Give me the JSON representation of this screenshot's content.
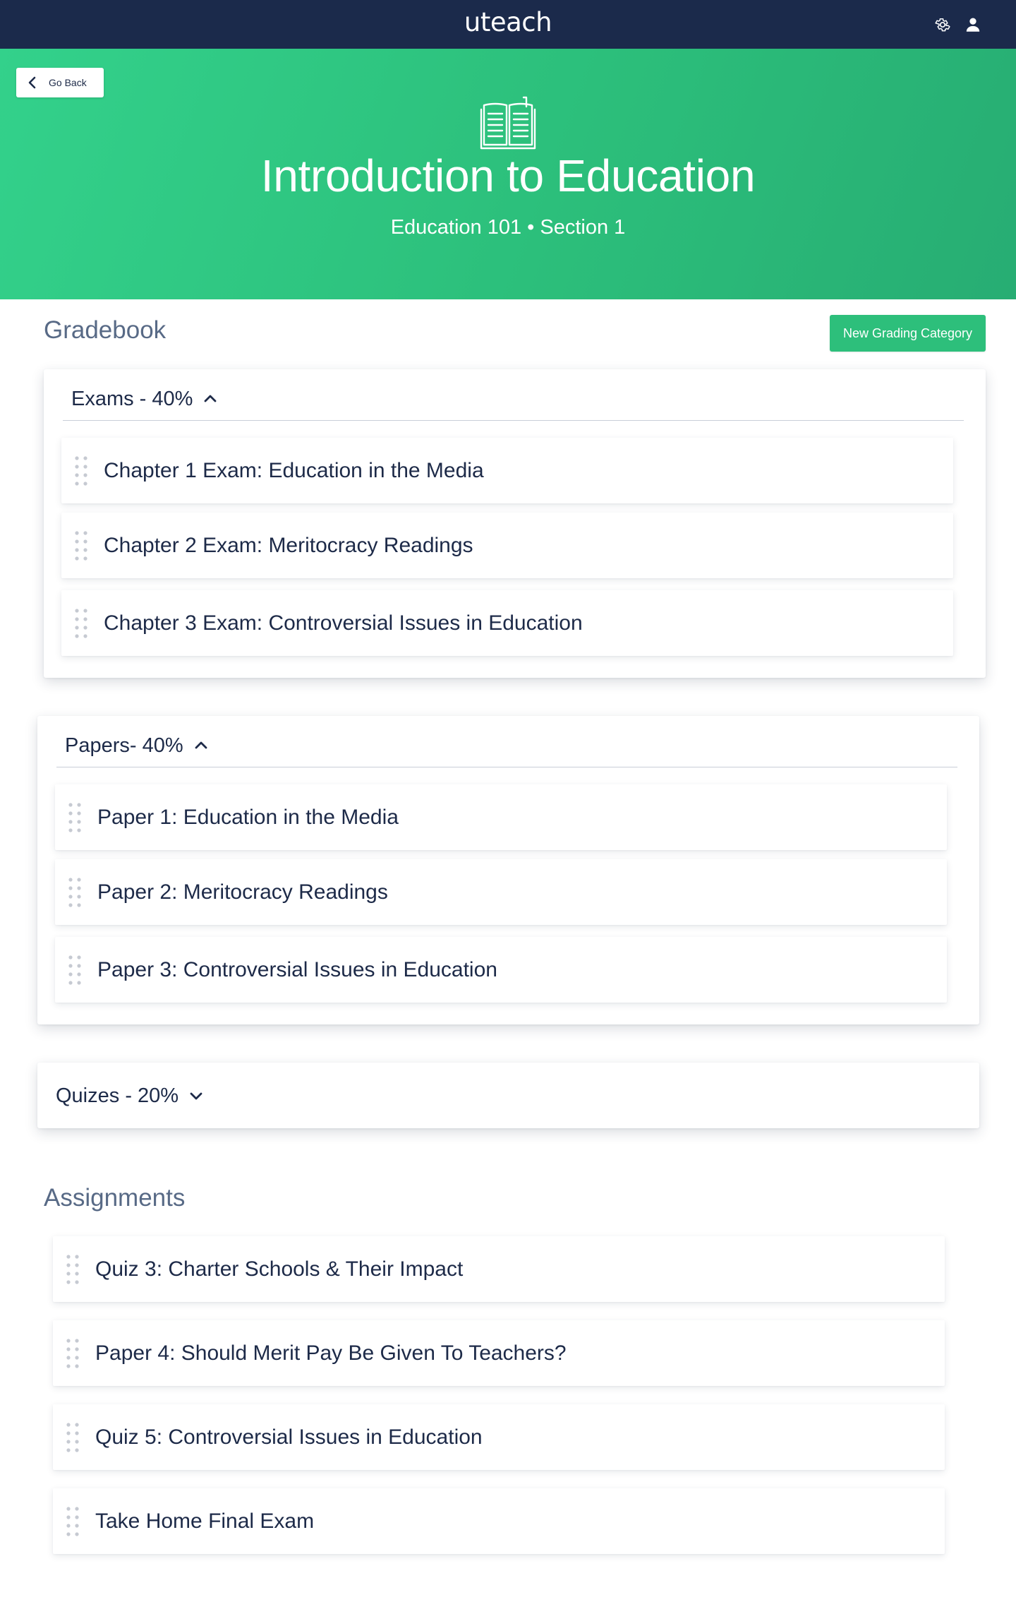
{
  "app": {
    "brand": "uteach"
  },
  "topbar_icons": {
    "settings": "gear-icon",
    "user": "user-icon"
  },
  "hero": {
    "back_label": "Go Back",
    "icon": "book-icon",
    "title": "Introduction to Education",
    "subtitle": "Education 101 • Section 1"
  },
  "gradebook": {
    "title": "Gradebook",
    "new_category_label": "New Grading Category",
    "categories": [
      {
        "label": "Exams - 40%",
        "expanded": true,
        "items": [
          "Chapter 1 Exam: Education in the Media",
          "Chapter 2 Exam: Meritocracy Readings",
          "Chapter 3 Exam: Controversial Issues in Education"
        ]
      },
      {
        "label": "Papers- 40%",
        "expanded": true,
        "items": [
          "Paper 1: Education in the Media",
          "Paper 2: Meritocracy Readings",
          "Paper 3: Controversial Issues in Education"
        ]
      },
      {
        "label": "Quizes - 20%",
        "expanded": false,
        "items": []
      }
    ]
  },
  "assignments": {
    "title": "Assignments",
    "items": [
      "Quiz 3: Charter Schools & Their Impact",
      "Paper 4: Should Merit Pay Be Given To Teachers?",
      "Quiz 5: Controversial Issues in Education",
      "Take Home Final Exam"
    ]
  },
  "colors": {
    "navy": "#1b2a4b",
    "green": "#2dbf7b",
    "text": "#1d2a48",
    "muted": "#586a86"
  }
}
